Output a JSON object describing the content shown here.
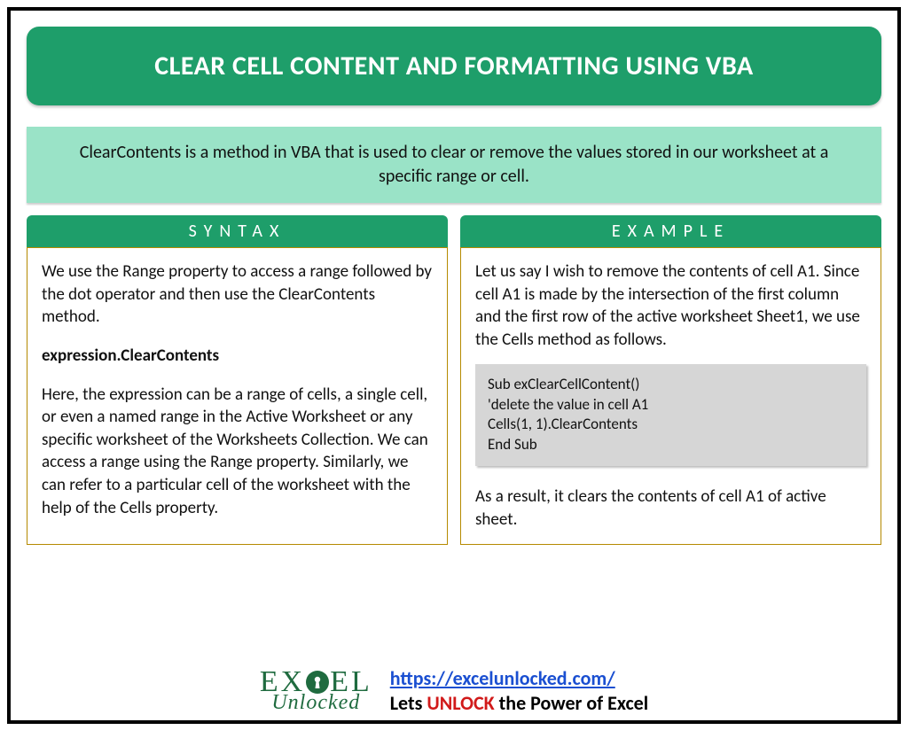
{
  "title": "CLEAR CELL CONTENT AND FORMATTING USING VBA",
  "intro": "ClearContents is a method in VBA that is used to clear or remove the values stored in our worksheet at a specific range or cell.",
  "syntax": {
    "header": "SYNTAX",
    "para1": "We use the Range property to access a range followed by the dot operator and then use the ClearContents method.",
    "expr": "expression.ClearContents",
    "para2": "Here, the expression can be a range of cells, a single cell, or even a named range in the Active Worksheet or any specific worksheet of the Worksheets Collection. We can access a range using the Range property. Similarly, we can refer to a particular cell of the worksheet with the help of the Cells property."
  },
  "example": {
    "header": "EXAMPLE",
    "para1": "Let us say I wish to remove the contents of cell A1. Since cell A1 is made by the intersection of the first column and the first row of the active worksheet Sheet1, we use the Cells method as follows.",
    "code": {
      "l1": "Sub exClearCellContent()",
      "l2": "'delete the value in cell A1",
      "l3": "Cells(1, 1).ClearContents",
      "l4": "End Sub"
    },
    "para2": "As a result, it clears the contents of cell A1 of active sheet."
  },
  "footer": {
    "logo_top_left": "EX",
    "logo_top_right": "EL",
    "logo_bottom": "Unlocked",
    "url": "https://excelunlocked.com/",
    "tagline_pre": "Lets ",
    "tagline_word": "UNLOCK",
    "tagline_post": " the Power of Excel"
  }
}
